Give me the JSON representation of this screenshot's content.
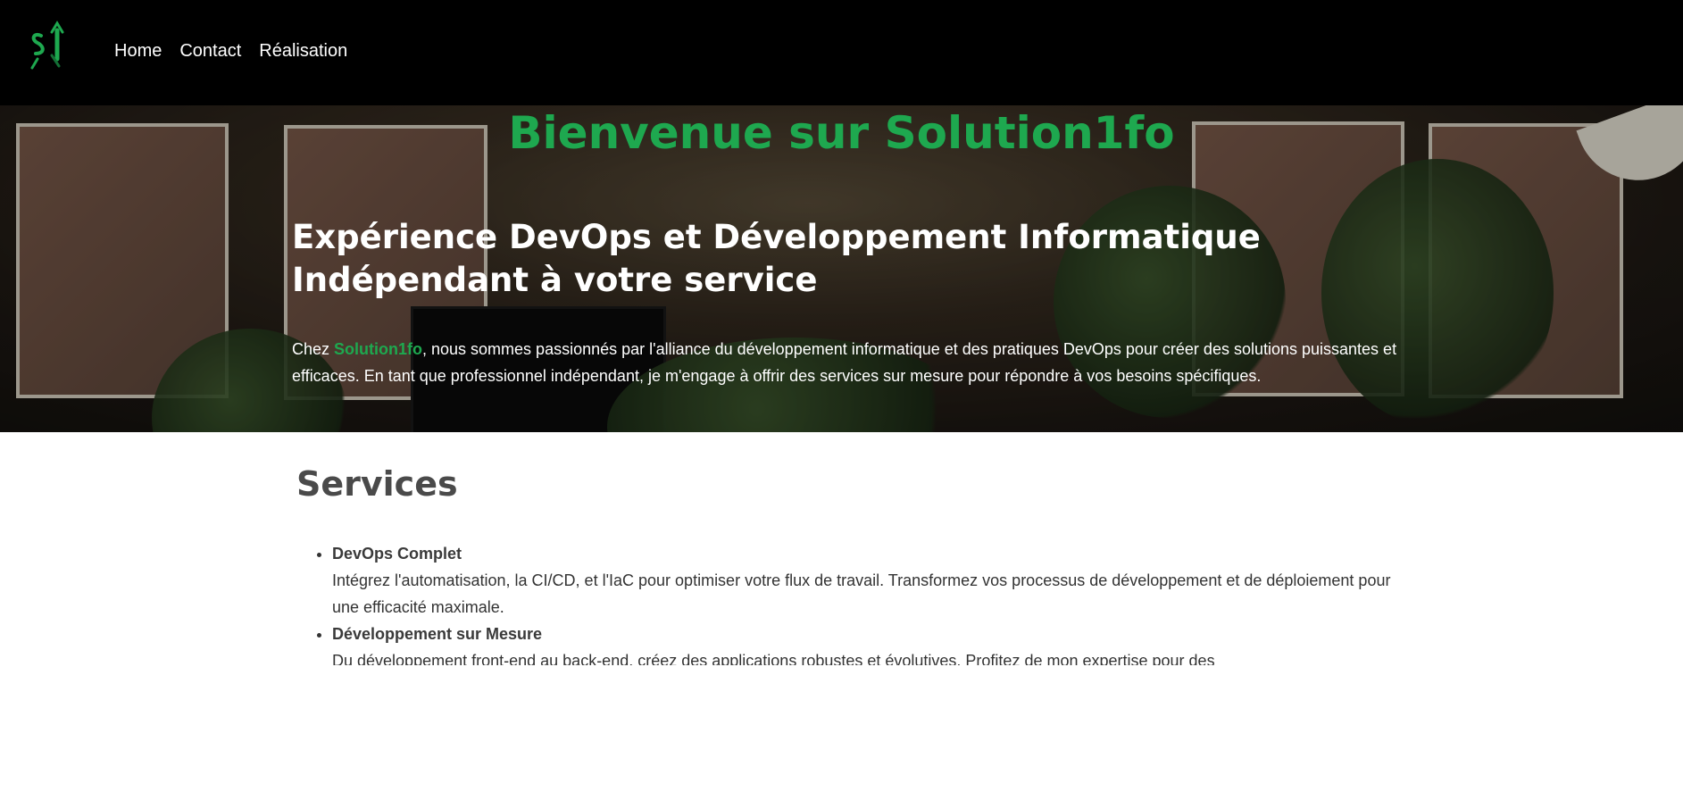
{
  "nav": {
    "logo_text": "S1",
    "links": [
      "Home",
      "Contact",
      "Réalisation"
    ]
  },
  "hero": {
    "title": "Bienvenue sur Solution1fo",
    "subtitle": "Expérience DevOps et Développement Informatique Indépendant à votre service",
    "intro_before": "Chez ",
    "intro_brand": "Solution1fo",
    "intro_after": ", nous sommes passionnés par l'alliance du développement informatique et des pratiques DevOps pour créer des solutions puissantes et efficaces. En tant que professionnel indépendant, je m'engage à offrir des services sur mesure pour répondre à vos besoins spécifiques."
  },
  "services": {
    "heading": "Services",
    "items": [
      {
        "name": "DevOps Complet",
        "description": "Intégrez l'automatisation, la CI/CD, et l'IaC pour optimiser votre flux de travail. Transformez vos processus de développement et de déploiement pour une efficacité maximale."
      },
      {
        "name": "Développement sur Mesure",
        "description": "Du développement front-end au back-end, créez des applications robustes et évolutives. Profitez de mon expertise pour des"
      }
    ]
  },
  "colors": {
    "brand_green": "#1ea84f",
    "navbar_bg": "#000000"
  }
}
